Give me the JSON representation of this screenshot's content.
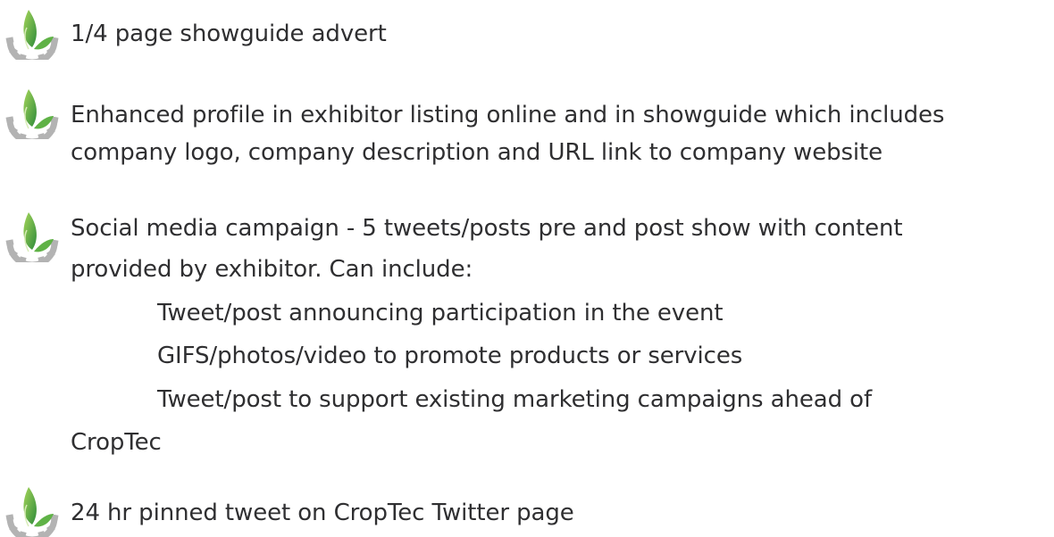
{
  "benefits": [
    {
      "icon": "leaf-gear-icon",
      "lines": [
        "1/4 page showguide advert"
      ]
    },
    {
      "icon": "leaf-gear-icon",
      "lines": [
        "Enhanced profile in exhibitor listing online and in showguide which includes",
        "company logo, company description and URL link to company website"
      ]
    },
    {
      "icon": "leaf-gear-icon",
      "lines": [
        "Social media campaign - 5 tweets/posts pre and post show with content",
        "provided by exhibitor. Can include:"
      ],
      "sub_items": [
        "Tweet/post announcing participation in the event",
        "GIFS/photos/video to promote products or services",
        "Tweet/post to support existing marketing campaigns ahead of"
      ],
      "continuation": "CropTec"
    },
    {
      "icon": "leaf-gear-icon",
      "lines": [
        "24 hr pinned tweet on CropTec Twitter page"
      ]
    }
  ],
  "colors": {
    "text": "#2f2f31",
    "leaf_light": "#8cc63f",
    "leaf_dark": "#2e8b3a",
    "gear": "#b3b3b3"
  }
}
